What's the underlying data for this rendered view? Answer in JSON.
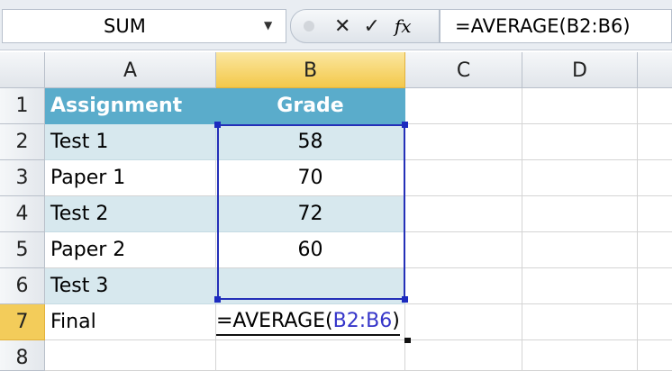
{
  "name_box": {
    "value": "SUM"
  },
  "formula_bar": {
    "cancel_icon": "✕",
    "enter_icon": "✓",
    "fx_label": "fx",
    "value": "=AVERAGE(B2:B6)"
  },
  "columns": [
    "A",
    "B",
    "C",
    "D"
  ],
  "rows": [
    "1",
    "2",
    "3",
    "4",
    "5",
    "6",
    "7",
    "8"
  ],
  "table": {
    "headers": [
      "Assignment",
      "Grade"
    ],
    "rows": [
      {
        "a": "Test 1",
        "b": "58"
      },
      {
        "a": "Paper 1",
        "b": "70"
      },
      {
        "a": "Test 2",
        "b": "72"
      },
      {
        "a": "Paper 2",
        "b": "60"
      },
      {
        "a": "Test 3",
        "b": ""
      }
    ]
  },
  "editing": {
    "label": "Final",
    "prefix": "=AVERAGE(",
    "ref": "B2:B6",
    "suffix": ")"
  },
  "colors": {
    "header": "#5aaccb",
    "band": "#d7e8ee",
    "range": "#2430b8"
  }
}
